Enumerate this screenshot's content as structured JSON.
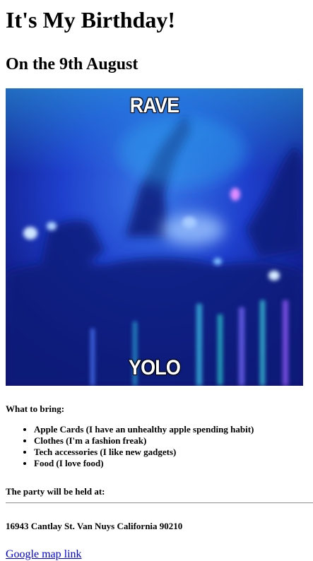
{
  "title": "It's My Birthday!",
  "subtitle": "On the 9th August",
  "image": {
    "top_caption": "RAVE",
    "bottom_caption": "YOLO"
  },
  "bring": {
    "heading": "What to bring:",
    "items": [
      "Apple Cards (I have an unhealthy apple spending habit)",
      "Clothes (I'm a fashion freak)",
      "Tech accessories (I like new gadgets)",
      "Food (I love food)"
    ]
  },
  "location": {
    "heading": "The party will be held at:",
    "address": "16943 Cantlay St. Van Nuys California 90210",
    "map_link_label": "Google map link"
  },
  "colors": {
    "link": "#0000ee",
    "image_base": "#1a1fa0"
  }
}
